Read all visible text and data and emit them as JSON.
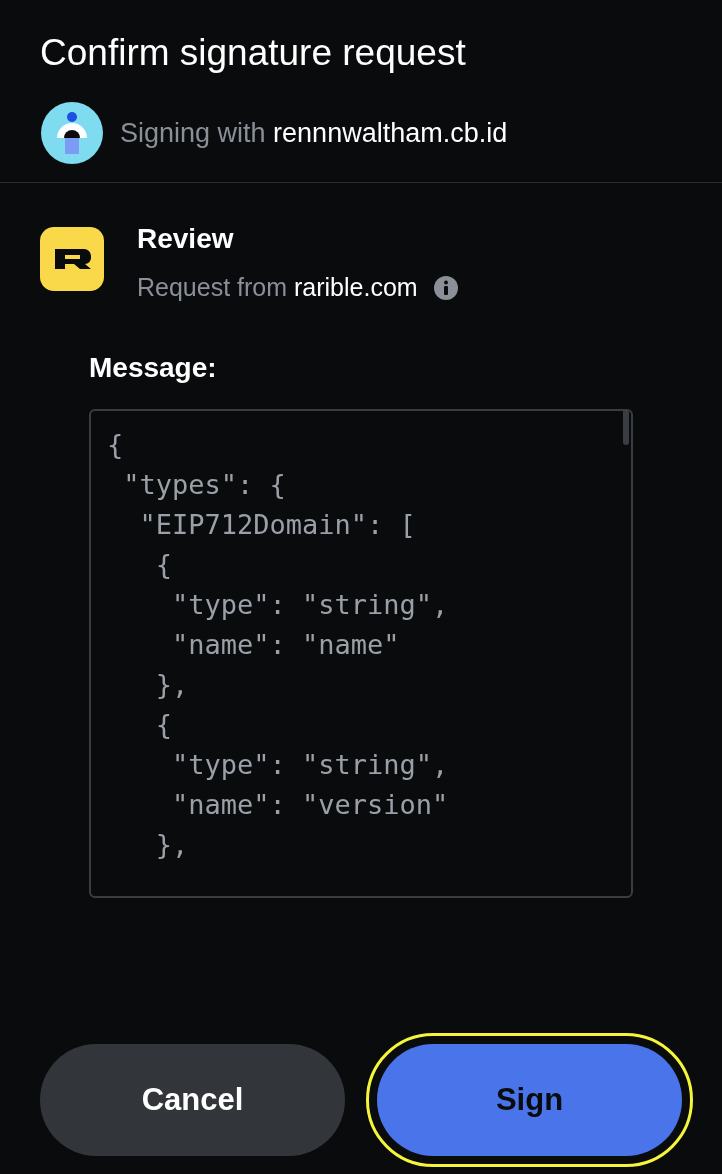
{
  "title": "Confirm signature request",
  "account": {
    "prefix": "Signing with",
    "name": "rennnwaltham.cb.id"
  },
  "request": {
    "title": "Review",
    "prefix": "Request from",
    "origin": "rarible.com"
  },
  "message": {
    "label": "Message:",
    "lines": [
      "{",
      " \"types\": {",
      "  \"EIP712Domain\": [",
      "   {",
      "    \"type\": \"string\",",
      "    \"name\": \"name\"",
      "   },",
      "   {",
      "    \"type\": \"string\",",
      "    \"name\": \"version\"",
      "   },"
    ]
  },
  "buttons": [
    {
      "label": "Cancel",
      "kind": "secondary",
      "highlighted": false
    },
    {
      "label": "Sign",
      "kind": "primary",
      "highlighted": true
    }
  ]
}
